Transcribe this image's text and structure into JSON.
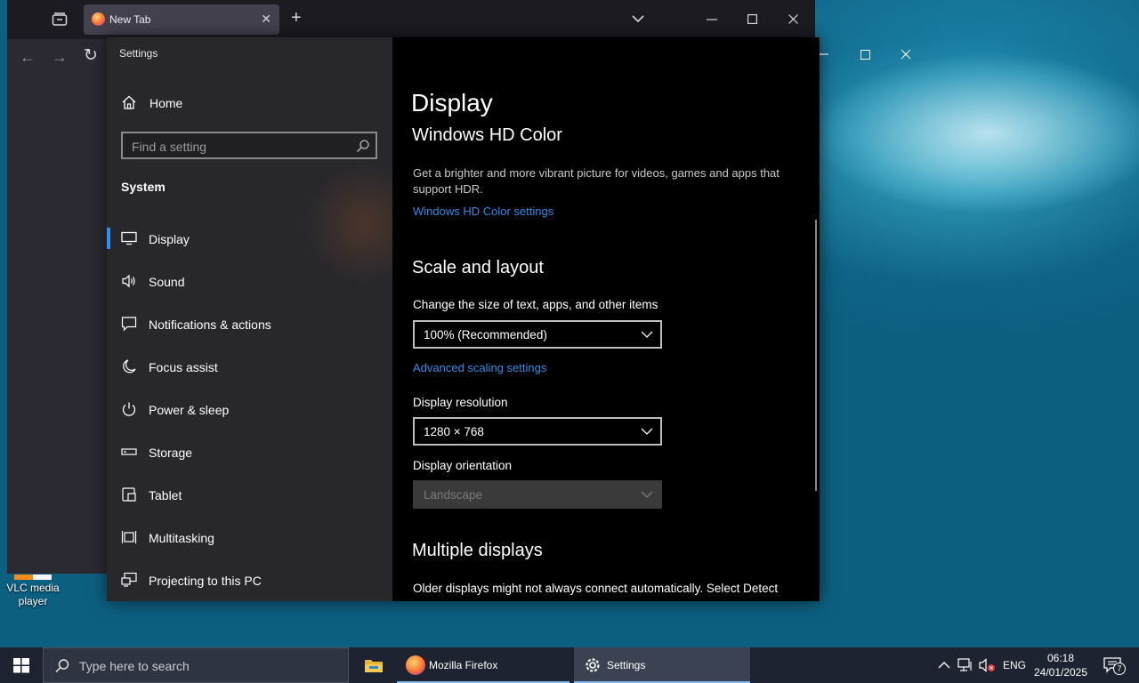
{
  "desktop": {
    "icons": [
      {
        "label": "VLC media player"
      }
    ]
  },
  "firefox": {
    "tab_title": "New Tab"
  },
  "settings": {
    "window_title": "Settings",
    "home_label": "Home",
    "search_placeholder": "Find a setting",
    "section": "System",
    "nav": [
      {
        "label": "Display",
        "icon": "monitor-icon",
        "active": true
      },
      {
        "label": "Sound",
        "icon": "speaker-icon"
      },
      {
        "label": "Notifications & actions",
        "icon": "notification-icon"
      },
      {
        "label": "Focus assist",
        "icon": "moon-icon"
      },
      {
        "label": "Power & sleep",
        "icon": "power-icon"
      },
      {
        "label": "Storage",
        "icon": "storage-icon"
      },
      {
        "label": "Tablet",
        "icon": "tablet-icon"
      },
      {
        "label": "Multitasking",
        "icon": "multitasking-icon"
      },
      {
        "label": "Projecting to this PC",
        "icon": "projecting-icon"
      }
    ],
    "content": {
      "page_title": "Display",
      "hd_color": {
        "heading": "Windows HD Color",
        "description": "Get a brighter and more vibrant picture for videos, games and apps that support HDR.",
        "link": "Windows HD Color settings"
      },
      "scale_layout": {
        "heading": "Scale and layout",
        "scale_label": "Change the size of text, apps, and other items",
        "scale_value": "100% (Recommended)",
        "advanced_link": "Advanced scaling settings",
        "resolution_label": "Display resolution",
        "resolution_value": "1280 × 768",
        "orientation_label": "Display orientation",
        "orientation_value": "Landscape"
      },
      "multiple_displays": {
        "heading": "Multiple displays",
        "description": "Older displays might not always connect automatically. Select Detect"
      }
    }
  },
  "taskbar": {
    "search_placeholder": "Type here to search",
    "apps": [
      {
        "label": "",
        "icon": "file-explorer-icon"
      },
      {
        "label": "Mozilla Firefox",
        "icon": "firefox-icon"
      },
      {
        "label": "Settings",
        "icon": "gear-icon"
      }
    ],
    "tray": {
      "language": "ENG",
      "time": "06:18",
      "date": "24/01/2025",
      "notification_count": "7"
    }
  },
  "colors": {
    "accent": "#2d8ff0",
    "link": "#2e8be6",
    "sidebar_bg": "#27272c",
    "content_bg": "#000000",
    "taskbar_bg": "#1d2330"
  }
}
